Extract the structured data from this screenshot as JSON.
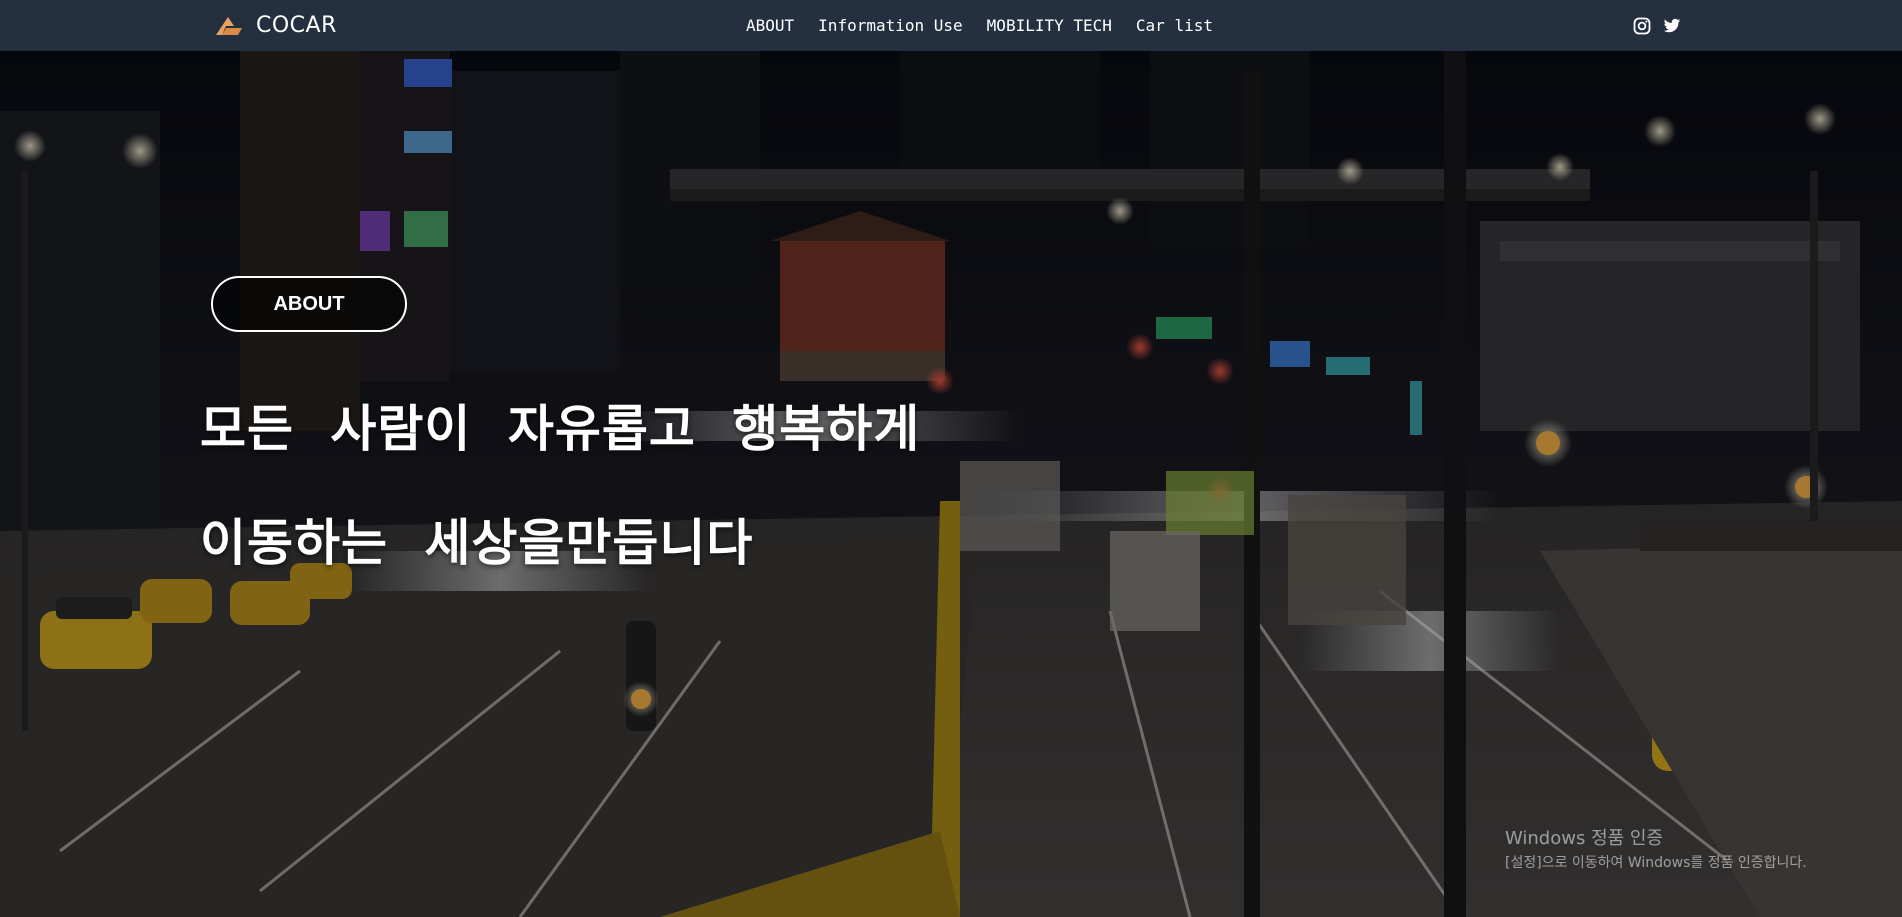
{
  "navbar": {
    "brand": "COCAR",
    "links": [
      {
        "label": "ABOUT"
      },
      {
        "label": "Information Use"
      },
      {
        "label": "MOBILITY TECH"
      },
      {
        "label": "Car list"
      }
    ],
    "social_icons": [
      "instagram-icon",
      "twitter-icon"
    ],
    "background_color": "#24303f"
  },
  "hero": {
    "button_label": "ABOUT",
    "headline_line1": "모든 사람이 자유롭고 행복하게",
    "headline_line2": "이동하는 세상을만듭니다"
  },
  "watermark": {
    "title": "Windows 정품 인증",
    "subtitle": "[설정]으로 이동하여 Windows를 정품 인증합니다."
  }
}
